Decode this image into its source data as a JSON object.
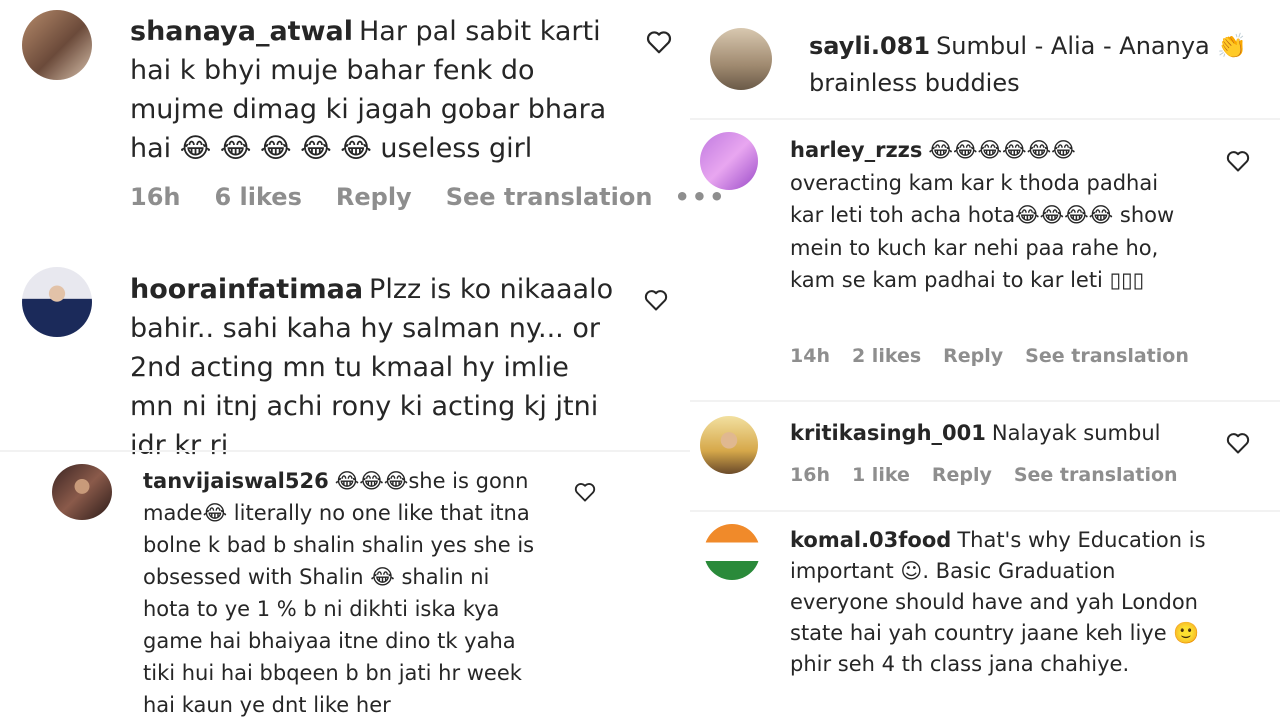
{
  "left": {
    "comment1": {
      "username": "shanaya_atwal",
      "text": "Har pal sabit karti hai k bhyi muje bahar fenk do mujme dimag ki jagah gobar bhara hai 😂 😂 😂 😂 😂 useless girl",
      "time": "16h",
      "likes": "6 likes",
      "reply": "Reply",
      "translate": "See translation",
      "more": "•••"
    },
    "comment2": {
      "username": "hoorainfatimaa",
      "text": "Plzz is ko nikaaalo bahir.. sahi kaha hy salman ny... or 2nd acting mn tu kmaal hy imlie mn ni itnj achi rony ki acting kj jtni idr kr ri"
    },
    "comment3": {
      "username": "tanvijaiswal526",
      "text": "😂😂😂she is gonn made😂 literally no one like that itna bolne k bad b shalin shalin yes she is obsessed with Shalin 😂 shalin ni hota to ye 1 % b ni dikhti iska kya game hai bhaiyaa itne dino tk yaha tiki hui hai bbqeen b bn jati hr week hai kaun ye dnt like her"
    }
  },
  "right": {
    "comment1": {
      "username": "sayli.081",
      "text": "Sumbul - Alia - Ananya 👏 brainless buddies"
    },
    "comment2": {
      "username": "harley_rzzs",
      "text": "😂😂😂😂😂😂 overacting kam kar k thoda padhai kar leti toh acha hota😂😂😂😂 show mein to kuch kar nehi paa rahe ho, kam se kam padhai to kar leti ▯▯▯",
      "time": "14h",
      "likes": "2 likes",
      "reply": "Reply",
      "translate": "See translation"
    },
    "comment3": {
      "username": "kritikasingh_001",
      "text": "Nalayak sumbul",
      "time": "16h",
      "likes": "1 like",
      "reply": "Reply",
      "translate": "See translation"
    },
    "comment4": {
      "username": "komal.03food",
      "text": "That's why Education is important ☺. Basic Graduation everyone should have and yah London state hai yah country jaane keh liye 🙂 phir seh 4 th class jana chahiye."
    }
  },
  "icons": {
    "heart": "heart-outline-icon",
    "avatar": "avatar-photo"
  }
}
